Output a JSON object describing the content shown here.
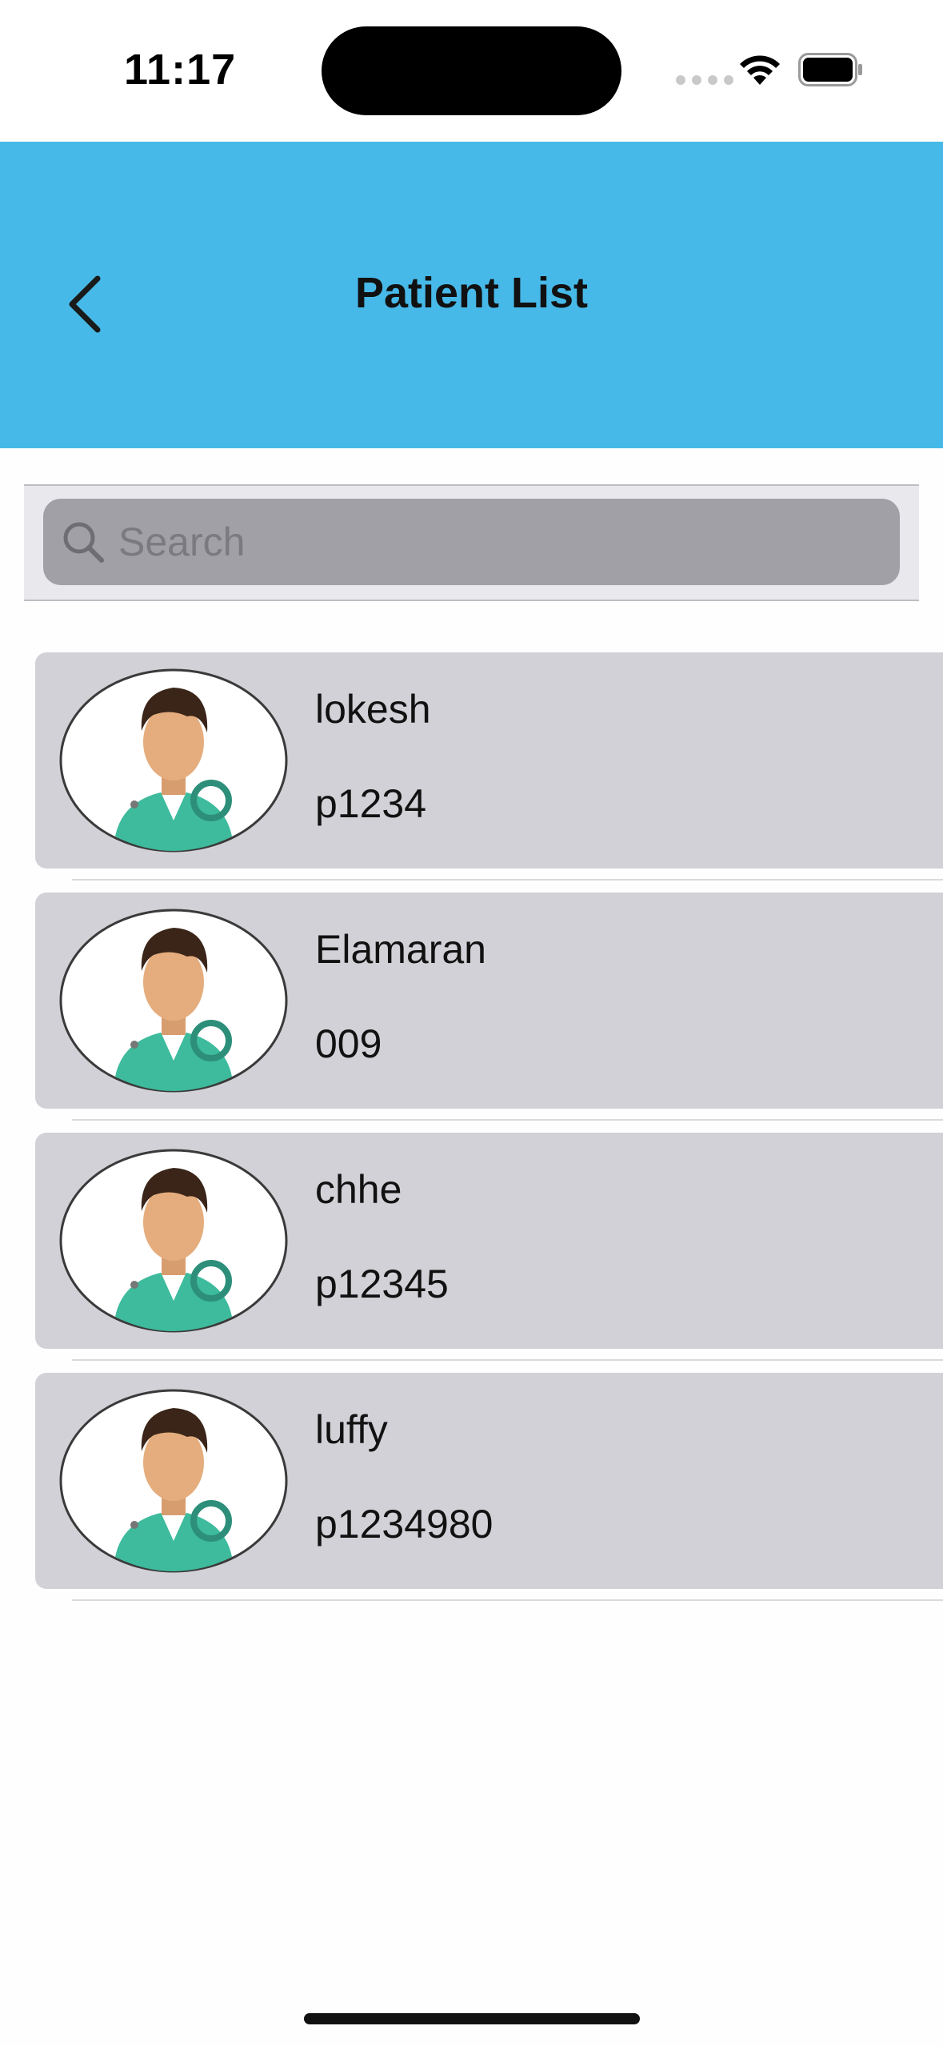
{
  "status_bar": {
    "time": "11:17"
  },
  "header": {
    "title": "Patient List",
    "back_icon": "chevron-left-icon"
  },
  "search": {
    "placeholder": "Search",
    "value": ""
  },
  "patients": [
    {
      "name": "lokesh",
      "id": "p1234"
    },
    {
      "name": "Elamaran",
      "id": "009"
    },
    {
      "name": "chhe",
      "id": "p12345"
    },
    {
      "name": "luffy",
      "id": "p1234980"
    }
  ],
  "colors": {
    "header": "#47b9e8",
    "card": "#d2d1d7",
    "search_field": "#a1a0a6"
  }
}
